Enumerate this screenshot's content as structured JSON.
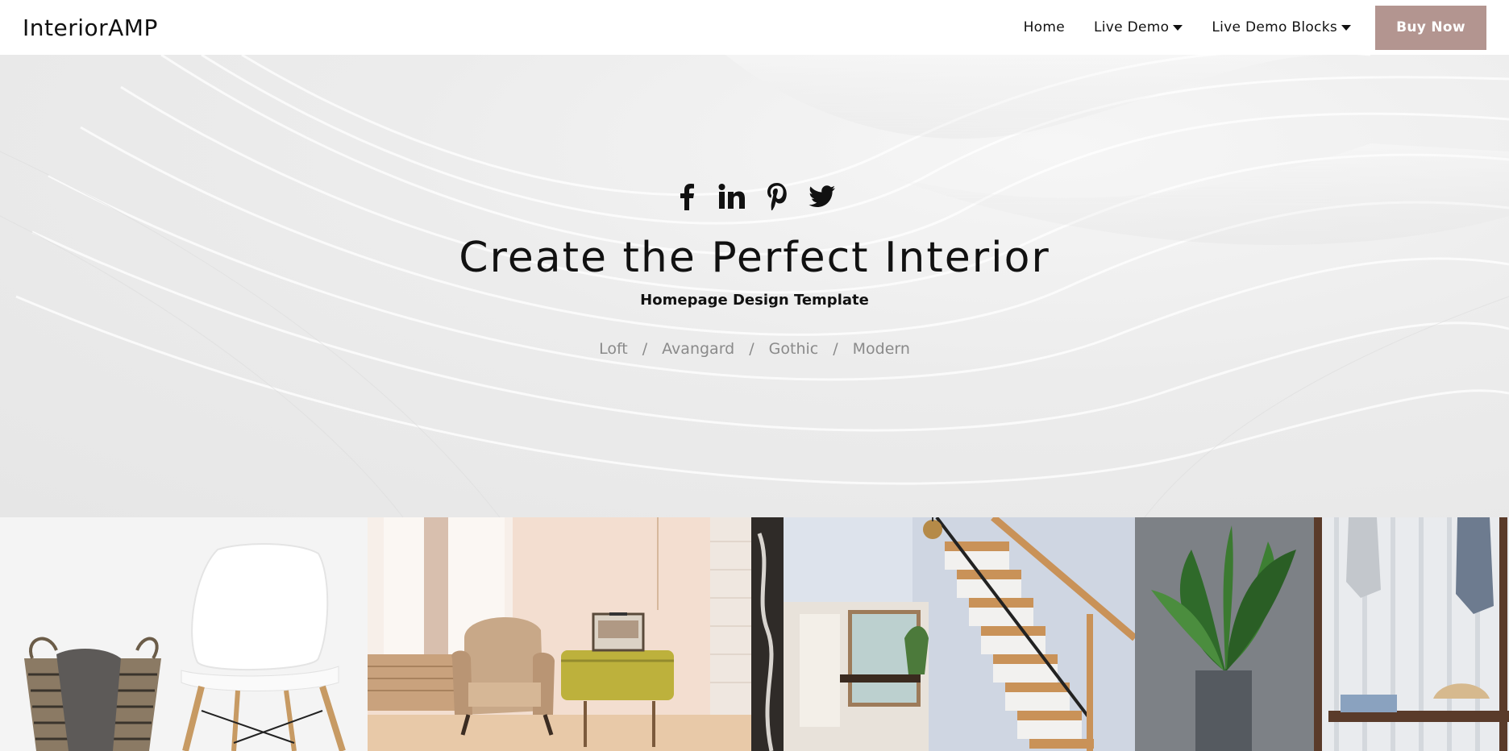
{
  "brand": "InteriorAMP",
  "nav": {
    "items": [
      {
        "label": "Home",
        "dropdown": false
      },
      {
        "label": "Live Demo",
        "dropdown": true
      },
      {
        "label": "Live Demo Blocks",
        "dropdown": true
      }
    ],
    "cta_label": "Buy Now",
    "cta_color": "#b39590"
  },
  "hero": {
    "social": [
      "facebook-icon",
      "linkedin-icon",
      "pinterest-icon",
      "twitter-icon"
    ],
    "title": "Create the Perfect Interior",
    "subtitle": "Homepage Design Template",
    "styles": [
      "Loft",
      "Avangard",
      "Gothic",
      "Modern"
    ],
    "separator": "/"
  },
  "gallery": [
    "chair-with-basket-photo",
    "armchair-with-suitcase-photo",
    "wooden-staircase-photo",
    "plant-and-bench-photo"
  ]
}
